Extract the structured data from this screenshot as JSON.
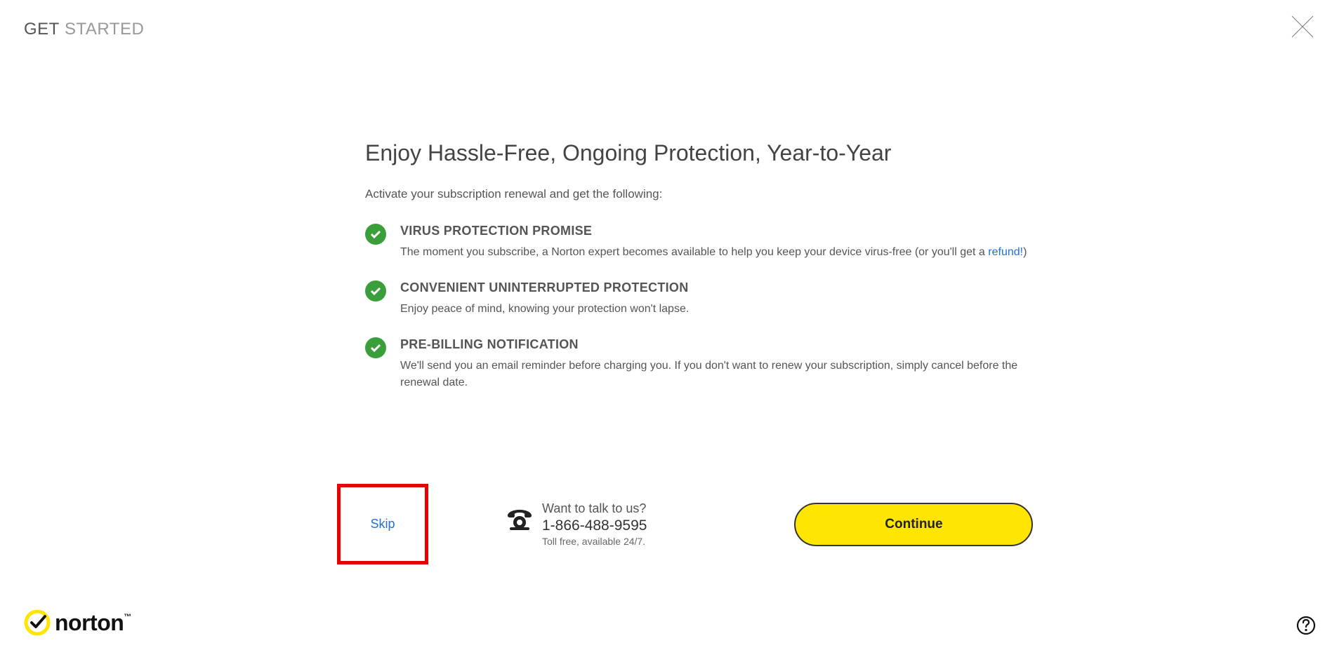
{
  "header": {
    "title_bold": "GET",
    "title_light": " STARTED"
  },
  "main": {
    "headline": "Enjoy Hassle-Free, Ongoing Protection, Year-to-Year",
    "subhead": "Activate your subscription renewal and get the following:",
    "features": [
      {
        "title": "VIRUS PROTECTION PROMISE",
        "desc_pre": "The moment you subscribe, a Norton expert becomes available to help you keep your device virus-free (or you'll get a ",
        "link": "refund!",
        "desc_post": ")"
      },
      {
        "title": "CONVENIENT UNINTERRUPTED PROTECTION",
        "desc": "Enjoy peace of mind, knowing your protection won't lapse."
      },
      {
        "title": "PRE-BILLING NOTIFICATION",
        "desc": "We'll send you an email reminder before charging you. If you don't want to renew your subscription, simply cancel before the renewal date."
      }
    ]
  },
  "actions": {
    "skip": "Skip",
    "phone_prompt": "Want to talk to us?",
    "phone_number": "1-866-488-9595",
    "phone_note": "Toll free, available 24/7.",
    "continue": "Continue"
  },
  "footer": {
    "brand": "norton",
    "tm": "™"
  }
}
